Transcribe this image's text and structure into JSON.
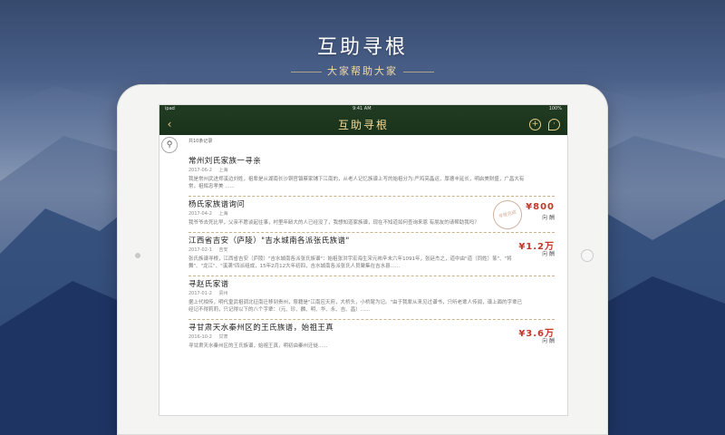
{
  "hero": {
    "title": "互助寻根",
    "subtitle": "大家帮助大家"
  },
  "status": {
    "left": "ipad",
    "time": "9:41 AM",
    "battery": "100%"
  },
  "nav": {
    "back_icon": "chevron-left-icon",
    "title": "互助寻根",
    "add_icon": "plus-circle-icon",
    "profile_icon": "location-pin-icon"
  },
  "list": {
    "count": "共10条记录",
    "items": [
      {
        "title": "常州刘氏家族一寻亲",
        "date": "2017-06-2",
        "location": "上海",
        "desc": "我是常州武进郑溪边刘姓，祖辈是从湖南长沙铜官镇蔡家铺下江南的，从老人记忆族谱上写的始祖分为:严鸡亮晶运，厚德丰延长，明启美财盛，广昌大有常，祖辉忠孝美 ......",
        "price": "",
        "note": ""
      },
      {
        "title": "杨氏家族谱询问",
        "date": "2017-04-2",
        "location": "上海",
        "desc": "我爷爷去死比早，父亲不愿谈起往事，村里年龄大的人已经没了，我想知道家族谱，现在不知道如何查询来恩 有朋友的请帮助我吗？",
        "price": "¥800",
        "note": "向 酬",
        "stamp": "寻根完成"
      },
      {
        "title": "江西省吉安（庐陵）\"吉水城南各派张氏族谱\"",
        "date": "2017-02-1",
        "location": "吉安",
        "desc": "张氏族谱寻根，江西省吉安（庐陵）\"吉水城南各派张氏族谱\"：始祖张洪宇宏海生宋元祐辛未六年1091年，张廷杰之，道中由\"道（同姓）篆\"、\"将舞\"、\"龙江\"、\"溪满\"四派组成，15年2月12大年初四，吉水城南各派张氏人员聚集在吉水县......",
        "price": "¥1.2万",
        "note": "向 酬"
      },
      {
        "title": "寻赵氏家谱",
        "date": "2017-01-2",
        "location": "贵州",
        "desc": "据上代相传，明代皇武祖调北征南迁移到贵州，祭籍是\"江南应天府，大桥头，小桥尾为记。\"由于我辈从来见过谱书，只听老辈人传闻，谱上面的字辈已经记不得莉莉，只记得以下的八个字辈：（元、珍、麟、明、华、永、吉、昌）......",
        "price": "",
        "note": ""
      },
      {
        "title": "寻甘肃天水秦州区的王氏族谱，始祖王真",
        "date": "2016-10-2",
        "location": "甘肃",
        "desc": "寻甘肃天水秦州区的王氏族谱，始祖王真，明初由秦州迁徙......",
        "price": "¥3.6万",
        "note": "向 酬"
      }
    ]
  }
}
